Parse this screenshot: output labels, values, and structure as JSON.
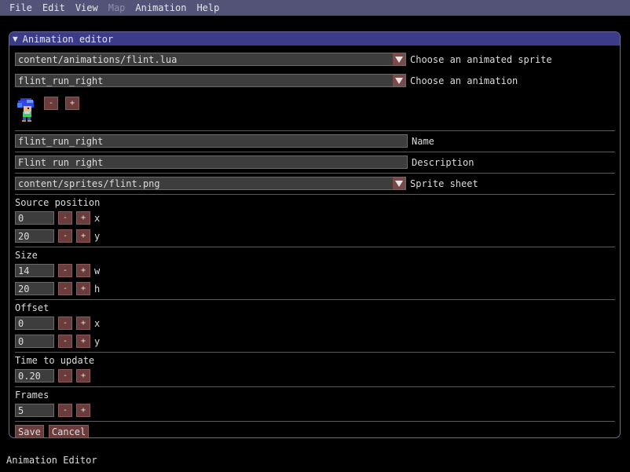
{
  "menu": [
    "File",
    "Edit",
    "View",
    "Map",
    "Animation",
    "Help"
  ],
  "window": {
    "title": "Animation editor"
  },
  "sprite_combo": {
    "value": "content/animations/flint.lua",
    "label": "Choose an animated sprite"
  },
  "animation_combo": {
    "value": "flint_run_right",
    "label": "Choose an animation"
  },
  "preview": {
    "minus": "-",
    "plus": "+"
  },
  "name_field": {
    "value": "flint_run_right",
    "label": "Name"
  },
  "description_field": {
    "value": "Flint run right",
    "label": "Description"
  },
  "sheet_combo": {
    "value": "content/sprites/flint.png",
    "label": "Sprite sheet"
  },
  "source_position": {
    "title": "Source position",
    "x": "0",
    "x_label": "x",
    "y": "20",
    "y_label": "y"
  },
  "size": {
    "title": "Size",
    "w": "14",
    "w_label": "w",
    "h": "20",
    "h_label": "h"
  },
  "offset": {
    "title": "Offset",
    "x": "0",
    "x_label": "x",
    "y": "0",
    "y_label": "y"
  },
  "time": {
    "title": "Time to update",
    "value": "0.20"
  },
  "frames": {
    "title": "Frames",
    "value": "5"
  },
  "stepper": {
    "minus": "-",
    "plus": "+"
  },
  "actions": {
    "save": "Save",
    "cancel": "Cancel"
  },
  "status": "Animation Editor",
  "colors": {
    "menubar": "#535378",
    "titlebar": "#3b3b8a",
    "button": "#6a3c3c",
    "input": "#3d3d3d"
  }
}
